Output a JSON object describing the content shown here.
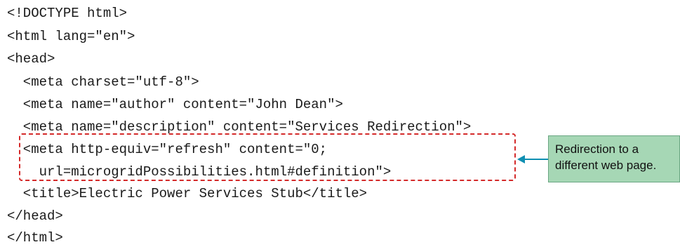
{
  "code": {
    "lines": [
      "<!DOCTYPE html>",
      "<html lang=\"en\">",
      "<head>",
      "  <meta charset=\"utf-8\">",
      "  <meta name=\"author\" content=\"John Dean\">",
      "  <meta name=\"description\" content=\"Services Redirection\">",
      "  <meta http-equiv=\"refresh\" content=\"0;",
      "    url=microgridPossibilities.html#definition\">",
      "  <title>Electric Power Services Stub</title>",
      "</head>",
      "</html>"
    ]
  },
  "callout": {
    "text": "Redirection to a\ndifferent web page."
  },
  "colors": {
    "highlight_border": "#d42a2a",
    "arrow": "#0f8fb2",
    "callout_bg": "#a6d7b5"
  }
}
